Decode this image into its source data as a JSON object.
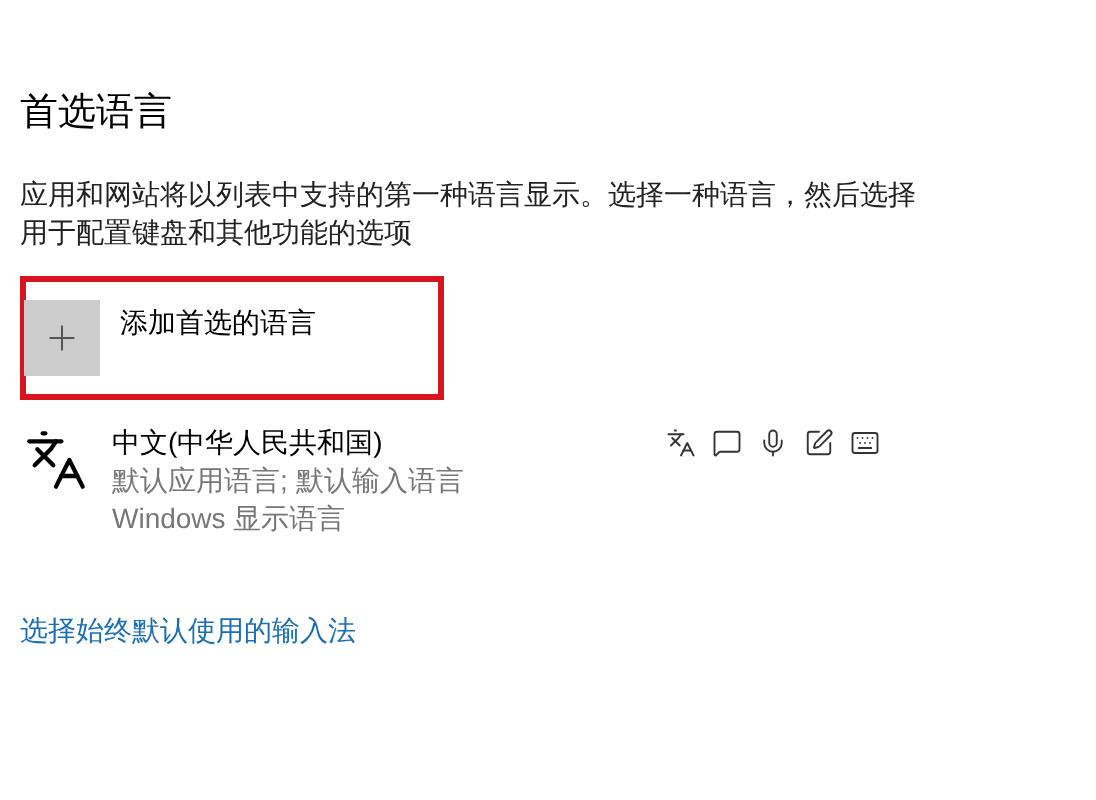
{
  "heading": "首选语言",
  "description": "应用和网站将以列表中支持的第一种语言显示。选择一种语言，然后选择用于配置键盘和其他功能的选项",
  "add_language": {
    "label": "添加首选的语言",
    "highlighted": true
  },
  "languages": [
    {
      "name": "中文(中华人民共和国)",
      "details": [
        "默认应用语言; 默认输入语言",
        "Windows 显示语言"
      ],
      "features": [
        {
          "kind": "language"
        },
        {
          "kind": "speech"
        },
        {
          "kind": "microphone"
        },
        {
          "kind": "handwriting"
        },
        {
          "kind": "keyboard"
        }
      ]
    }
  ],
  "link": "选择始终默认使用的输入法"
}
